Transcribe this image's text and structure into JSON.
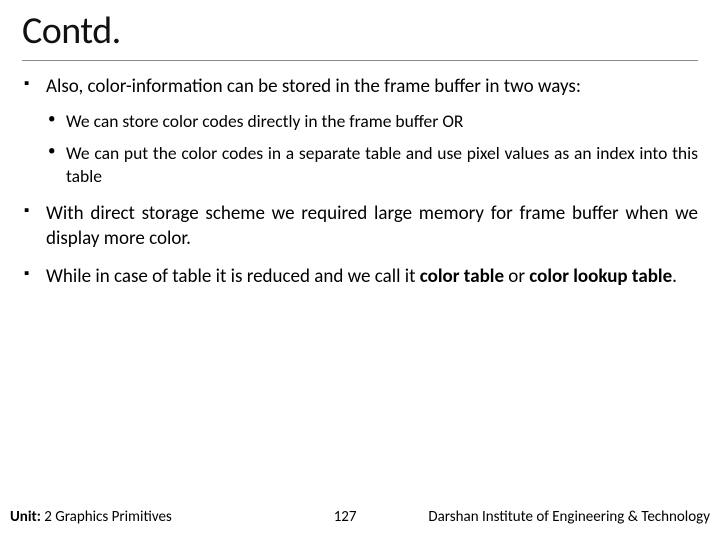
{
  "title": "Contd.",
  "bullets": {
    "b1": "Also, color-information can be stored in the frame buffer in two ways:",
    "b1a": "We can store color codes directly in the frame buffer OR",
    "b1b": "We can put the color codes in a separate table and use pixel values as an index into this table",
    "b2": "With direct storage scheme we required large memory for frame buffer when we display more color.",
    "b3_pre": "While in case of table it is reduced and we call it ",
    "b3_bold1": "color table",
    "b3_mid": " or ",
    "b3_bold2": "color lookup table",
    "b3_post": "."
  },
  "footer": {
    "unit_label": "Unit:",
    "unit_text": " 2 Graphics Primitives",
    "page": "127",
    "org": "Darshan Institute of Engineering & Technology"
  }
}
